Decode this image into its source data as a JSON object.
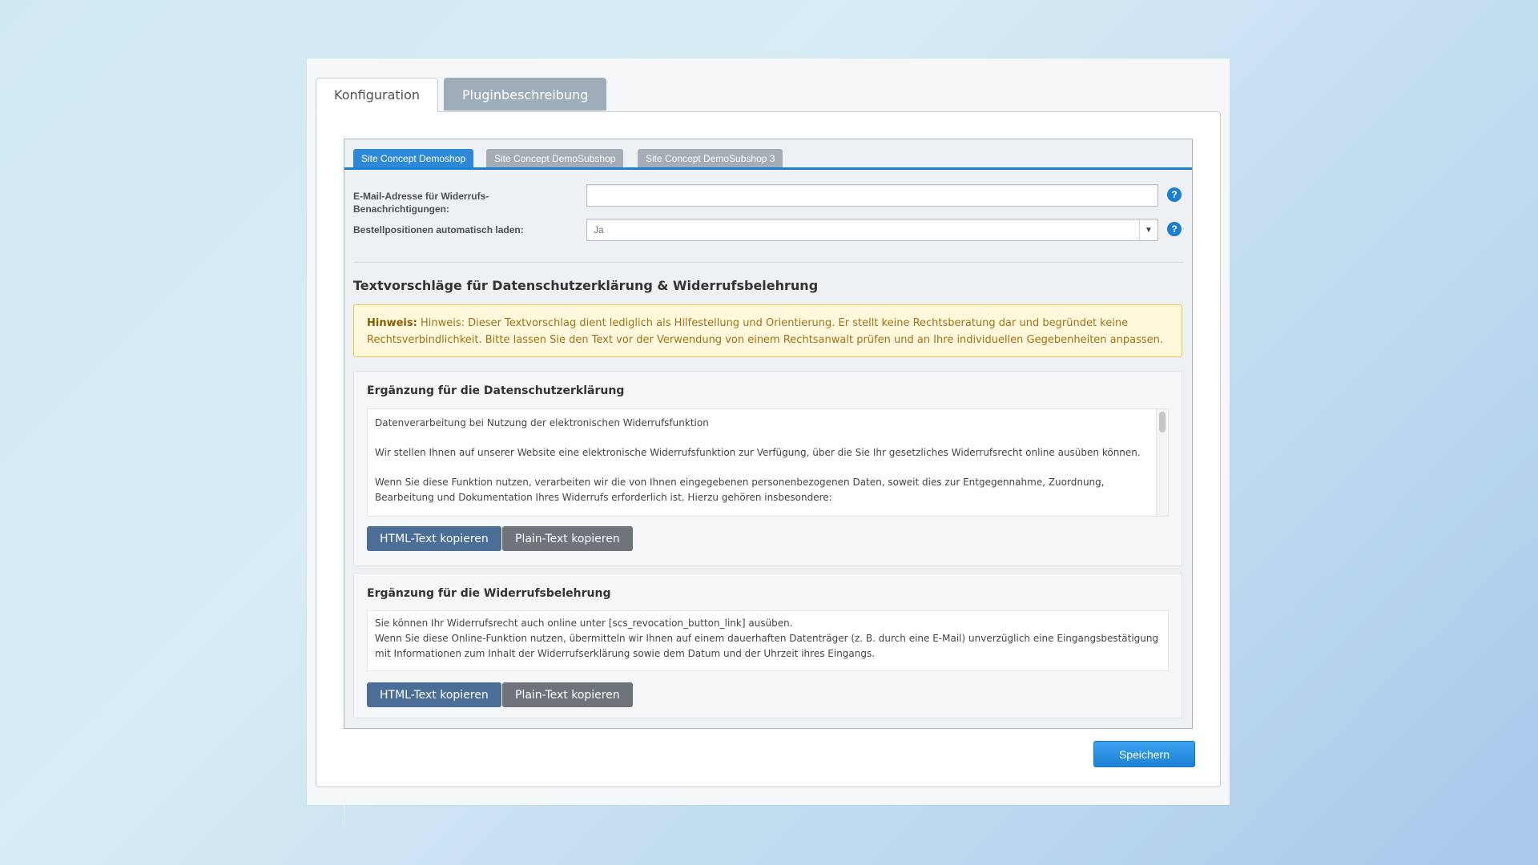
{
  "main_tabs": [
    {
      "label": "Konfiguration",
      "active": true
    },
    {
      "label": "Pluginbeschreibung",
      "active": false
    }
  ],
  "shop_tabs": [
    {
      "label": "Site Concept Demoshop",
      "active": true
    },
    {
      "label": "Site Concept DemoSubshop",
      "active": false
    },
    {
      "label": "Site Concept DemoSubshop 3",
      "active": false
    }
  ],
  "form": {
    "email_label_line1": "E-Mail-Adresse für Widerrufs-",
    "email_label_line2": "Benachrichtigungen:",
    "email_value": "",
    "autoload_label": "Bestellpositionen automatisch laden:",
    "autoload_value": "Ja",
    "help_glyph": "?"
  },
  "section_title": "Textvorschläge für Datenschutzerklärung & Widerrufsbelehrung",
  "hint": {
    "prefix": "Hinweis:",
    "text": "Hinweis: Dieser Textvorschlag dient lediglich als Hilfestellung und Orientierung. Er stellt keine Rechtsberatung dar und begründet keine Rechtsverbindlichkeit. Bitte lassen Sie den Text vor der Verwendung von einem Rechtsanwalt prüfen und an Ihre individuellen Gegebenheiten anpassen."
  },
  "privacy_card": {
    "title": "Ergänzung für die Datenschutzerklärung",
    "paragraphs": [
      "Datenverarbeitung bei Nutzung der elektronischen Widerrufsfunktion",
      "Wir stellen Ihnen auf unserer Website eine elektronische Widerrufsfunktion zur Verfügung, über die Sie Ihr gesetzliches Widerrufsrecht online ausüben können.",
      "Wenn Sie diese Funktion nutzen, verarbeiten wir die von Ihnen eingegebenen personenbezogenen Daten, soweit dies zur Entgegennahme, Zuordnung, Bearbeitung und Dokumentation Ihres Widerrufs erforderlich ist. Hierzu gehören insbesondere:"
    ],
    "html_button": "HTML-Text kopieren",
    "plain_button": "Plain-Text kopieren"
  },
  "revocation_card": {
    "title": "Ergänzung für die Widerrufsbelehrung",
    "line1": "Sie können Ihr Widerrufsrecht auch online unter [scs_revocation_button_link] ausüben.",
    "line2": "Wenn Sie diese Online-Funktion nutzen, übermitteln wir Ihnen auf einem dauerhaften Datenträger (z. B. durch eine E-Mail) unverzüglich eine Eingangsbestätigung mit Informationen zum Inhalt der Widerrufserklärung sowie dem Datum und der Uhrzeit ihres Eingangs.",
    "html_button": "HTML-Text kopieren",
    "plain_button": "Plain-Text kopieren"
  },
  "save_button": "Speichern",
  "icons": {
    "help": "question-circle-icon",
    "dropdown": "chevron-down-icon"
  },
  "colors": {
    "accent": "#1a7fd1",
    "hint_bg": "#fff8dc",
    "hint_border": "#f0c447",
    "html_button": "#4a6e95",
    "plain_button": "#6e7479"
  }
}
